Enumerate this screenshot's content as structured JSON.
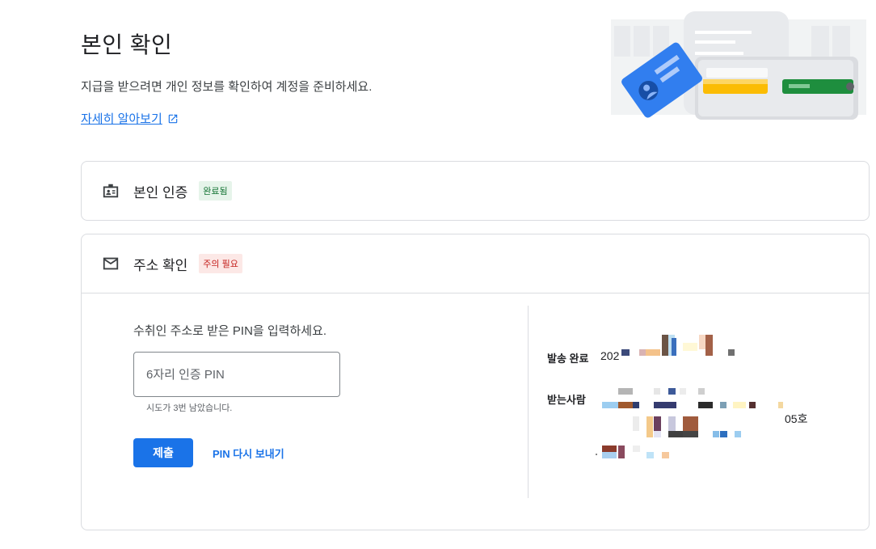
{
  "header": {
    "title": "본인 확인",
    "description": "지급을 받으려면 개인 정보를 확인하여 계정을 준비하세요.",
    "learn_more": "자세히 알아보기"
  },
  "identity_card": {
    "title": "본인 인증",
    "badge": "완료됨",
    "icon": "id-badge-icon"
  },
  "address_card": {
    "title": "주소 확인",
    "badge": "주의 필요",
    "icon": "mail-icon",
    "pin_prompt": "수취인 주소로 받은 PIN을 입력하세요.",
    "pin_placeholder": "6자리 인증 PIN",
    "pin_value": "",
    "attempts_text": "시도가 3번 남았습니다.",
    "submit_label": "제출",
    "resend_label": "PIN 다시 보내기",
    "sent_label": "발송 완료",
    "sent_value_visible": "202",
    "recipient_label": "받는사람",
    "recipient_visible_tail": "05호"
  },
  "colors": {
    "primary": "#1a73e8",
    "success_bg": "#e6f4ea",
    "success_text": "#137333",
    "warning_bg": "#fce8e6",
    "warning_text": "#c5221f"
  }
}
